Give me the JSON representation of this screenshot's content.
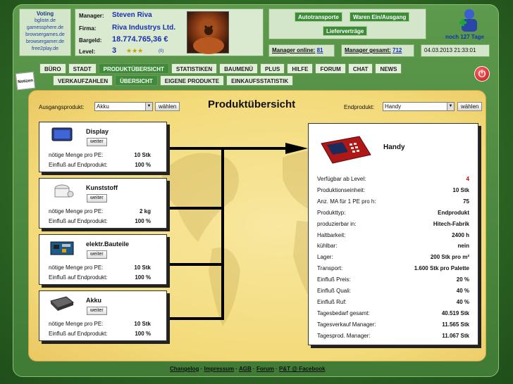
{
  "voting": {
    "title": "Voting",
    "links": [
      "bgliste.de",
      "gamessphere.de",
      "browsergames.de",
      "browsergamer.de",
      "free2play.de"
    ]
  },
  "manager": {
    "labels": {
      "manager": "Manager:",
      "firma": "Firma:",
      "bargeld": "Bargeld:",
      "level": "Level:"
    },
    "name": "Steven Riva",
    "firma": "Riva Industrys Ltd.",
    "bargeld": "18.774.765,36 €",
    "level": "3",
    "stars": "★★★",
    "level_small": "(0)"
  },
  "transport": {
    "buttons": [
      "Autotransporte",
      "Waren Ein/Ausgang",
      "Lieferverträge"
    ]
  },
  "status": {
    "online_label": "Manager online:",
    "online_value": "81",
    "total_label": "Manager gesamt:",
    "total_value": "712",
    "datetime": "04.03.2013 21:33:01",
    "days_left": "noch 127 Tage"
  },
  "nav": {
    "main": [
      "BÜRO",
      "STADT",
      "PRODUKTÜBERSICHT",
      "STATISTIKEN",
      "BAUMENÜ",
      "PLUS",
      "HILFE",
      "FORUM",
      "CHAT",
      "NEWS"
    ],
    "active_main": 2,
    "sub": [
      "VERKAUFZAHLEN",
      "ÜBERSICHT",
      "EIGENE PRODUKTE",
      "EINKAUFSSTATISTIK"
    ],
    "active_sub": 1,
    "notizen": "Notizen"
  },
  "page": {
    "title": "Produktübersicht",
    "ausgang_label": "Ausgangsprodukt:",
    "ausgang_value": "Akku",
    "end_label": "Endprodukt:",
    "end_value": "Handy",
    "choose_button": "wählen"
  },
  "components": [
    {
      "name": "Display",
      "button": "weiter",
      "menge_label": "nötige Menge pro PE:",
      "menge": "10 Stk",
      "einfluss_label": "Einfluß auf Endprodukt:",
      "einfluss": "100 %"
    },
    {
      "name": "Kunststoff",
      "button": "weiter",
      "menge_label": "nötige Menge pro PE:",
      "menge": "2 kg",
      "einfluss_label": "Einfluß auf Endprodukt:",
      "einfluss": "100 %"
    },
    {
      "name": "elektr.Bauteile",
      "button": "weiter",
      "menge_label": "nötige Menge pro PE:",
      "menge": "10 Stk",
      "einfluss_label": "Einfluß auf Endprodukt:",
      "einfluss": "100 %"
    },
    {
      "name": "Akku",
      "button": "weiter",
      "menge_label": "nötige Menge pro PE:",
      "menge": "10 Stk",
      "einfluss_label": "Einfluß auf Endprodukt:",
      "einfluss": "100 %"
    }
  ],
  "product": {
    "name": "Handy",
    "rows": [
      {
        "label": "Verfügbar ab Level:",
        "value": "4",
        "accent": "#cc0000"
      },
      {
        "label": "Produktionseinheit:",
        "value": "10 Stk"
      },
      {
        "label": "Anz. MA für 1 PE pro h:",
        "value": "75"
      },
      {
        "label": "Produkttyp:",
        "value": "Endprodukt"
      },
      {
        "label": "produzierbar in:",
        "value": "Hitech-Fabrik"
      },
      {
        "label": "Haltbarkeit:",
        "value": "2400 h"
      },
      {
        "label": "kühlbar:",
        "value": "nein"
      },
      {
        "label": "Lager:",
        "value": "200 Stk pro m²"
      },
      {
        "label": "Transport:",
        "value": "1.600 Stk pro Palette"
      },
      {
        "label": "Einfluß Preis:",
        "value": "20 %"
      },
      {
        "label": "Einfluß Quali:",
        "value": "40 %"
      },
      {
        "label": "Einfluß Ruf:",
        "value": "40 %"
      },
      {
        "label": "Tagesbedarf gesamt:",
        "value": "40.519 Stk"
      },
      {
        "label": "Tagesverkauf Manager:",
        "value": "11.565 Stk"
      },
      {
        "label": "Tagesprod. Manager:",
        "value": "11.067 Stk"
      }
    ]
  },
  "footer": {
    "links": [
      "Changelog",
      "Impressum",
      "AGB",
      "Forum",
      "P&T @ Facebook"
    ],
    "separator": "·"
  }
}
